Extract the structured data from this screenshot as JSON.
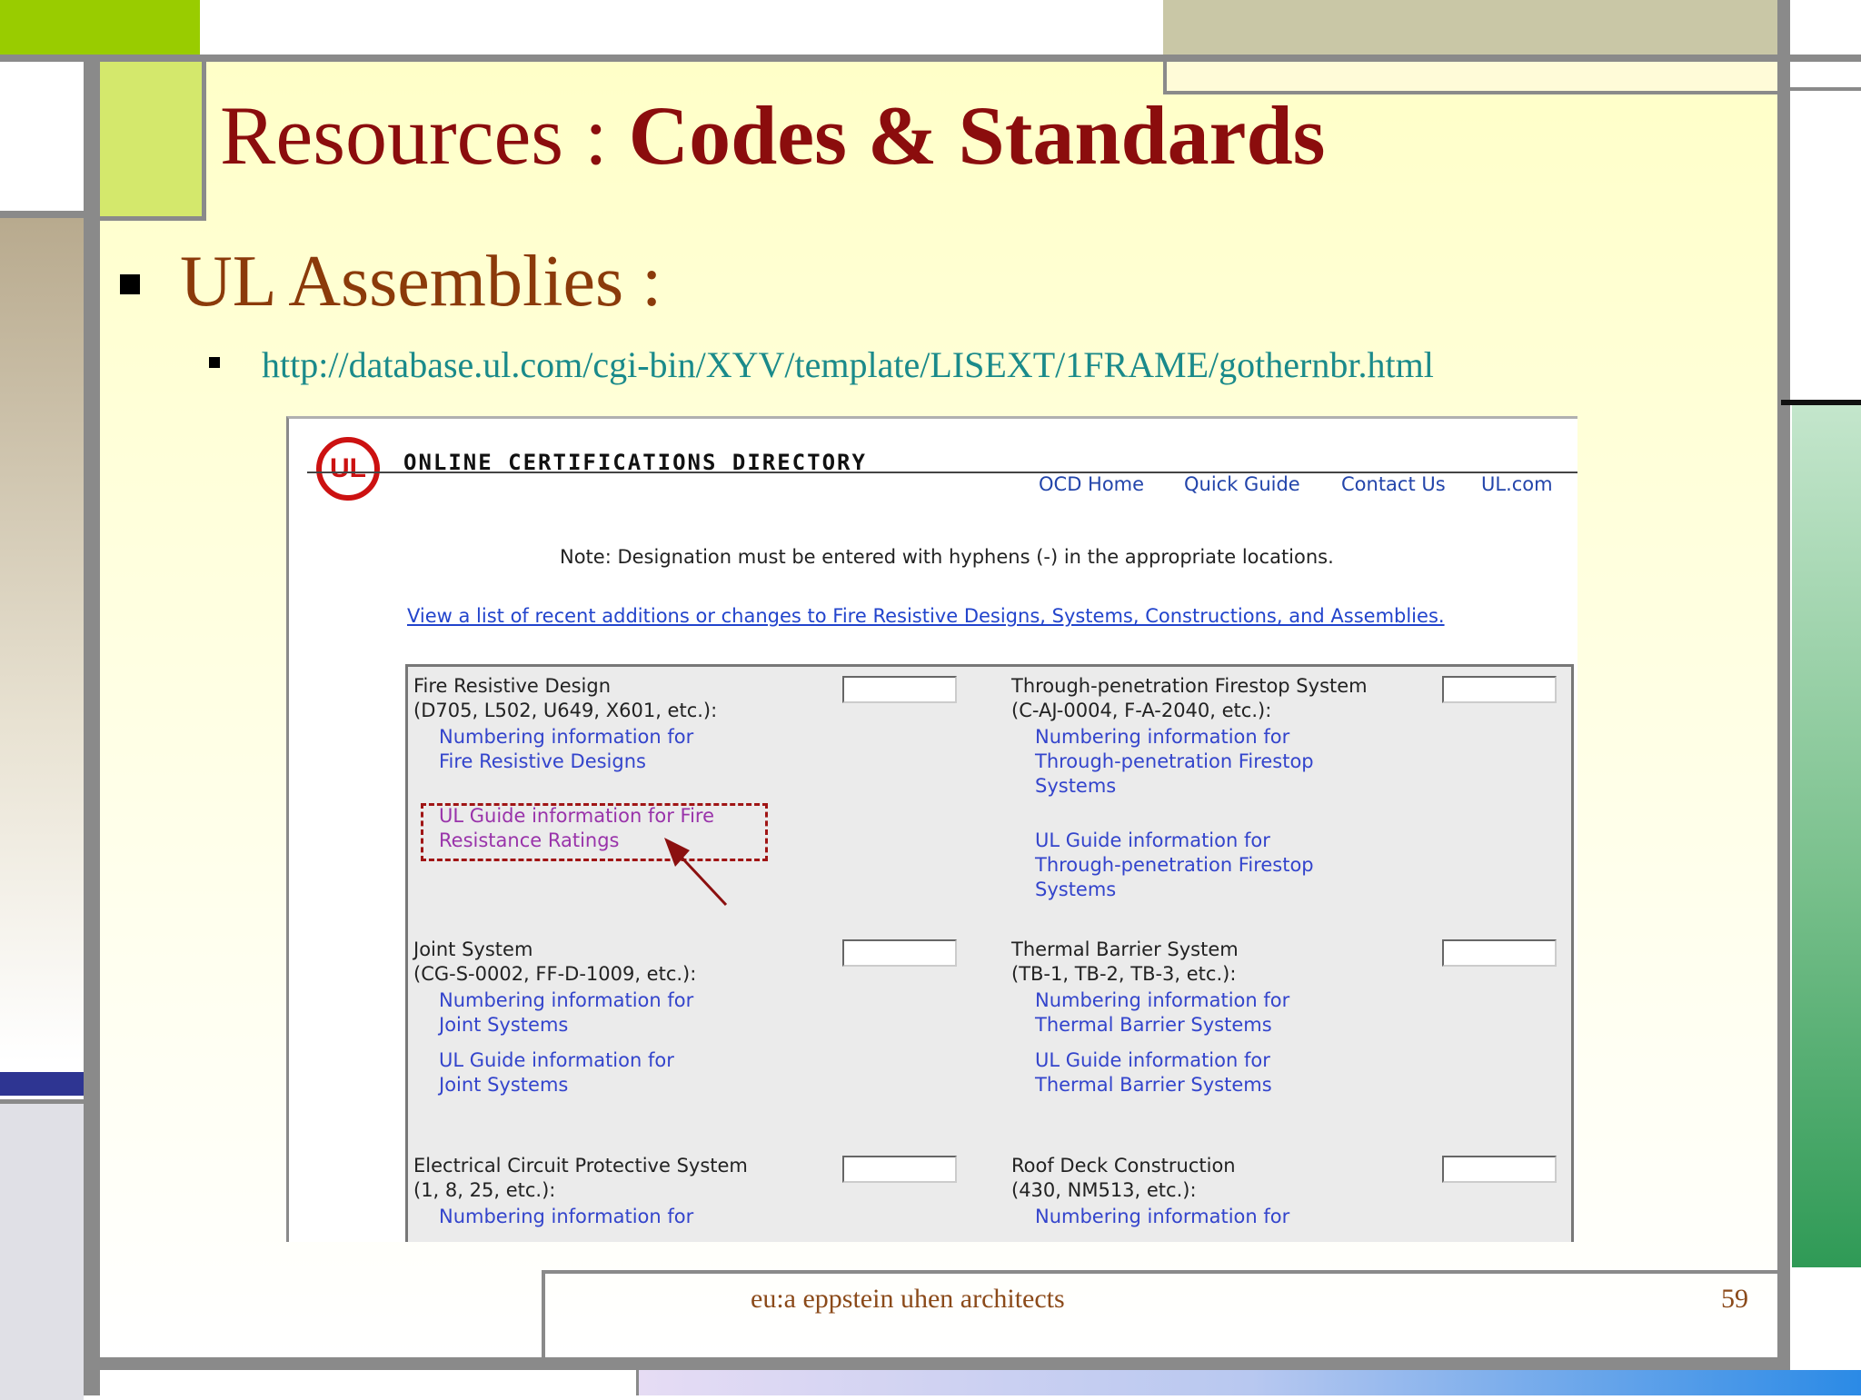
{
  "slide": {
    "title_plain": "Resources : ",
    "title_bold": "Codes & Standards",
    "bullet1": "UL Assemblies :",
    "bullet2": "http://database.ul.com/cgi-bin/XYV/template/LISEXT/1FRAME/gothernbr.html",
    "footer": "eu:a   eppstein uhen architects",
    "page_number": "59"
  },
  "screenshot": {
    "logo_text": "UL",
    "directory_title": "ONLINE CERTIFICATIONS DIRECTORY",
    "nav": [
      "OCD Home",
      "Quick Guide",
      "Contact Us",
      "UL.com"
    ],
    "note": "Note: Designation must be entered with hyphens (-) in the appropriate locations.",
    "recent_link": "View a list of recent additions or changes to Fire Resistive Designs, Systems, Constructions, and Assemblies.",
    "left_col": {
      "fire_label1": "Fire Resistive Design",
      "fire_label2": "(D705, L502, U649, X601, etc.):",
      "fire_num1": "Numbering information for",
      "fire_num2": "Fire Resistive Designs",
      "fire_guide1": "UL Guide information for Fire",
      "fire_guide2": "Resistance Ratings",
      "joint_label1": "Joint System",
      "joint_label2": "(CG-S-0002, FF-D-1009, etc.):",
      "joint_num1": "Numbering information for",
      "joint_num2": "Joint Systems",
      "joint_guide1": "UL Guide information for",
      "joint_guide2": "Joint Systems",
      "elec_label1": "Electrical Circuit Protective System",
      "elec_label2": "(1, 8, 25, etc.):",
      "elec_num1": "Numbering information for"
    },
    "right_col": {
      "tp_label1": "Through-penetration Firestop System",
      "tp_label2": "(C-AJ-0004, F-A-2040, etc.):",
      "tp_num1": "Numbering information for",
      "tp_num2": "Through-penetration Firestop",
      "tp_num3": "Systems",
      "tp_guide1": "UL Guide information for",
      "tp_guide2": "Through-penetration Firestop",
      "tp_guide3": "Systems",
      "tb_label1": "Thermal Barrier System",
      "tb_label2": "(TB-1, TB-2, TB-3, etc.):",
      "tb_num1": "Numbering information for",
      "tb_num2": "Thermal Barrier Systems",
      "tb_guide1": "UL Guide information for",
      "tb_guide2": "Thermal Barrier Systems",
      "roof_label1": "Roof Deck Construction",
      "roof_label2": "(430, NM513, etc.):",
      "roof_num1": "Numbering information for"
    }
  }
}
